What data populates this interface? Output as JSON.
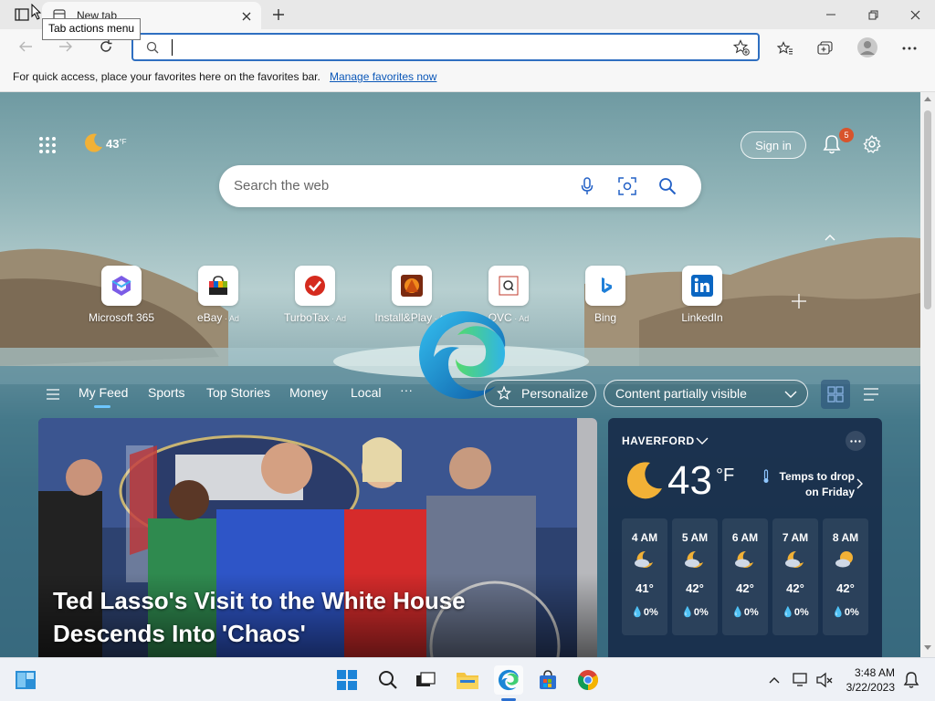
{
  "browser": {
    "tab_title": "New tab",
    "tooltip": "Tab actions menu",
    "address_value": "",
    "favorites_message": "For quick access, place your favorites here on the favorites bar.",
    "favorites_link": "Manage favorites now"
  },
  "page": {
    "weather_temp": "43",
    "weather_unit": "°F",
    "sign_in": "Sign in",
    "notification_count": "5",
    "search_placeholder": "Search the web",
    "shortcuts": [
      {
        "label": "Microsoft 365",
        "ad": ""
      },
      {
        "label": "eBay",
        "ad": "Ad"
      },
      {
        "label": "TurboTax",
        "ad": "Ad"
      },
      {
        "label": "Install&Play",
        "ad": "Ad"
      },
      {
        "label": "QVC",
        "ad": "Ad"
      },
      {
        "label": "Bing",
        "ad": ""
      },
      {
        "label": "LinkedIn",
        "ad": ""
      }
    ],
    "nav": [
      "My Feed",
      "Sports",
      "Top Stories",
      "Money",
      "Local",
      "···"
    ],
    "personalize": "Personalize",
    "content_filter": "Content partially visible",
    "headline": "Ted Lasso's Visit to the White House Descends Into 'Chaos'"
  },
  "weather": {
    "location": "HAVERFORD",
    "temp": "43",
    "unit": "°F",
    "alert": "Temps to drop on Friday",
    "hours": [
      {
        "time": "4 AM",
        "temp": "41°",
        "precip": "0%"
      },
      {
        "time": "5 AM",
        "temp": "42°",
        "precip": "0%"
      },
      {
        "time": "6 AM",
        "temp": "42°",
        "precip": "0%"
      },
      {
        "time": "7 AM",
        "temp": "42°",
        "precip": "0%"
      },
      {
        "time": "8 AM",
        "temp": "42°",
        "precip": "0%"
      }
    ]
  },
  "taskbar": {
    "time": "3:48 AM",
    "date": "3/22/2023"
  }
}
